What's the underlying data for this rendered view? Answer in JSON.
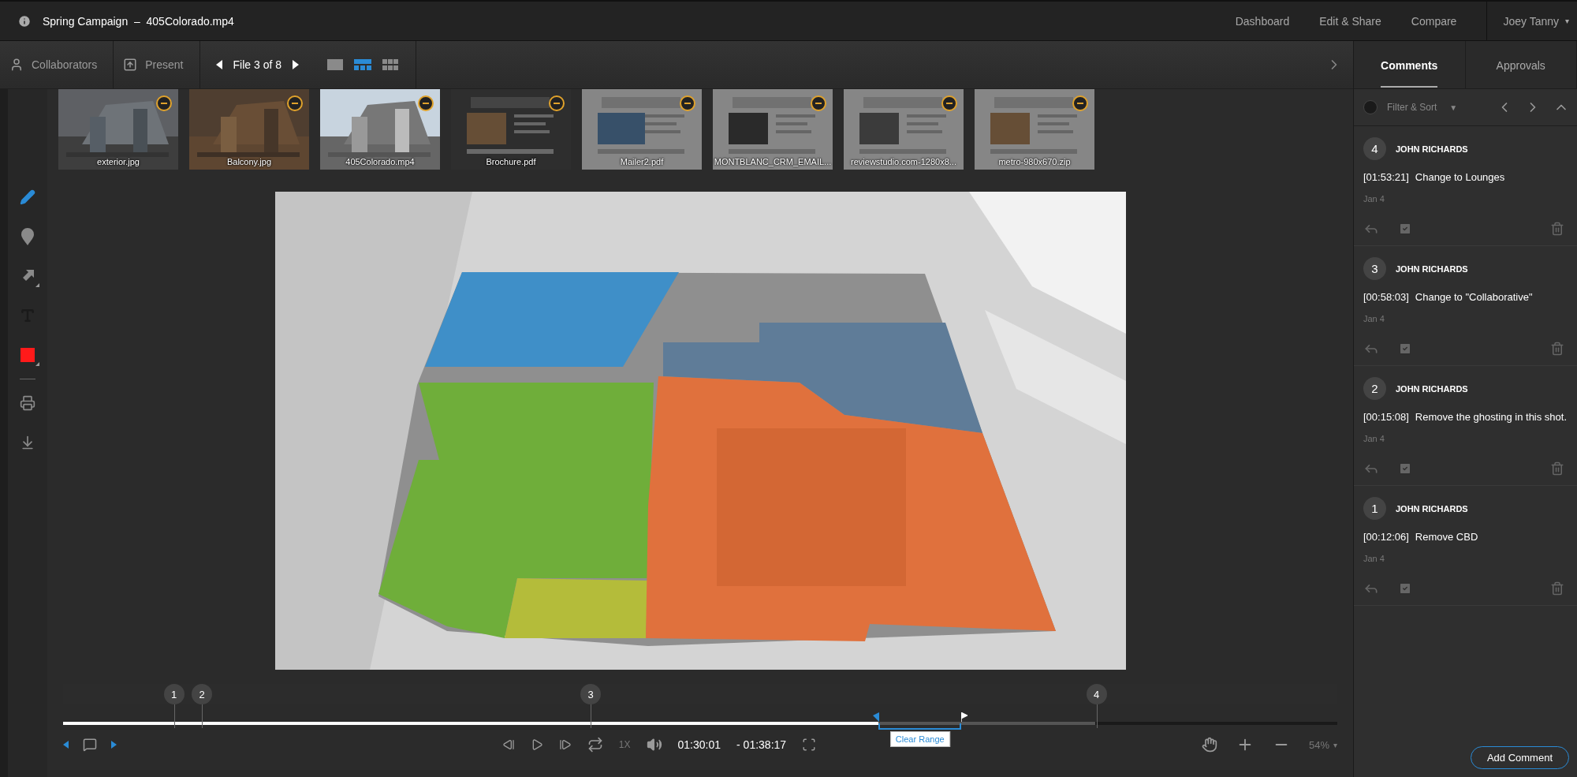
{
  "header": {
    "project": "Spring Campaign",
    "separator": "–",
    "file": "405Colorado.mp4",
    "nav": [
      "Dashboard",
      "Edit & Share",
      "Compare"
    ],
    "user": "Joey Tanny",
    "user_caret": "▾"
  },
  "toolbar": {
    "collaborators": "Collaborators",
    "present": "Present",
    "file_counter": "File 3 of 8",
    "view_modes": [
      {
        "kind": "single",
        "selected": false
      },
      {
        "kind": "filmstrip",
        "selected": true
      },
      {
        "kind": "grid",
        "selected": false
      }
    ]
  },
  "tools": [
    {
      "kind": "pencil",
      "selected": true
    },
    {
      "kind": "pin",
      "selected": false
    },
    {
      "kind": "arrow",
      "selected": false
    },
    {
      "kind": "text",
      "selected": false
    },
    {
      "kind": "color",
      "selected": false,
      "color": "#ff1a1a"
    }
  ],
  "actions": [
    {
      "kind": "print"
    },
    {
      "kind": "download"
    }
  ],
  "thumbnails": [
    {
      "name": "exterior.jpg",
      "selected": false
    },
    {
      "name": "Balcony.jpg",
      "selected": false
    },
    {
      "name": "405Colorado.mp4",
      "selected": true
    },
    {
      "name": "Brochure.pdf",
      "selected": false
    },
    {
      "name": "Mailer2.pdf",
      "selected": false
    },
    {
      "name": "MONTBLANC_CRM_EMAIL...",
      "selected": false
    },
    {
      "name": "reviewstudio.com-1280x8...",
      "selected": false
    },
    {
      "name": "metro-980x670.zip",
      "selected": false
    }
  ],
  "timeline": {
    "level": 0.64,
    "buffer": {
      "level": 0.81
    },
    "range_end": {
      "level": 0.705
    },
    "clear_range": "Clear Range",
    "markers": [
      {
        "label": "1",
        "level": 0.087
      },
      {
        "label": "2",
        "level": 0.109
      },
      {
        "label": "3",
        "level": 0.414
      },
      {
        "label": "4",
        "level": 0.811
      }
    ]
  },
  "player": {
    "speed": "1X",
    "elapsed": "01:30:01",
    "remaining": "- 01:38:17",
    "zoom": "54%",
    "zoom_caret": "▾"
  },
  "panel": {
    "tabs": [
      {
        "label": "Comments",
        "selected": true
      },
      {
        "label": "Approvals",
        "selected": false
      }
    ],
    "filter": "Filter & Sort",
    "filter_caret": "▼",
    "comments": [
      {
        "number": "4",
        "author": "JOHN RICHARDS",
        "timecode": "[01:53:21]",
        "text": "Change to Lounges",
        "date": "Jan 4"
      },
      {
        "number": "3",
        "author": "JOHN RICHARDS",
        "timecode": "[00:58:03]",
        "text": "Change to \"Collaborative\"",
        "date": "Jan 4"
      },
      {
        "number": "2",
        "author": "JOHN RICHARDS",
        "timecode": "[00:15:08]",
        "text": "Remove the ghosting in this shot.",
        "date": "Jan 4"
      },
      {
        "number": "1",
        "author": "JOHN RICHARDS",
        "timecode": "[00:12:06]",
        "text": "Remove CBD",
        "date": "Jan 4"
      }
    ],
    "add_comment": "Add Comment"
  }
}
